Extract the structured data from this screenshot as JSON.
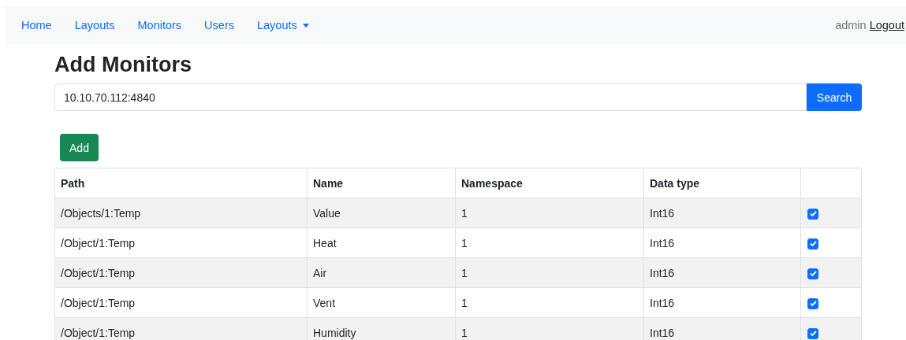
{
  "nav": {
    "items": [
      {
        "label": "Home",
        "kind": "link"
      },
      {
        "label": "Layouts",
        "kind": "link"
      },
      {
        "label": "Monitors",
        "kind": "link"
      },
      {
        "label": "Users",
        "kind": "link"
      },
      {
        "label": "Layouts",
        "kind": "dropdown"
      }
    ],
    "user": "admin",
    "logout": "Logout"
  },
  "title": "Add Monitors",
  "search": {
    "value": "10.10.70.112:4840",
    "button": "Search"
  },
  "add_button": "Add",
  "table": {
    "columns": [
      "Path",
      "Name",
      "Namespace",
      "Data type"
    ],
    "rows": [
      {
        "cells": [
          "/Objects/1:Temp",
          "Value",
          "1",
          "Int16"
        ],
        "checked": true
      },
      {
        "cells": [
          "/Object/1:Temp",
          "Heat",
          "1",
          "Int16"
        ],
        "checked": true
      },
      {
        "cells": [
          "/Object/1:Temp",
          "Air",
          "1",
          "Int16"
        ],
        "checked": true
      },
      {
        "cells": [
          "/Object/1:Temp",
          "Vent",
          "1",
          "Int16"
        ],
        "checked": true
      },
      {
        "cells": [
          "/Object/1:Temp",
          "Humidity",
          "1",
          "Int16"
        ],
        "checked": true
      }
    ]
  }
}
